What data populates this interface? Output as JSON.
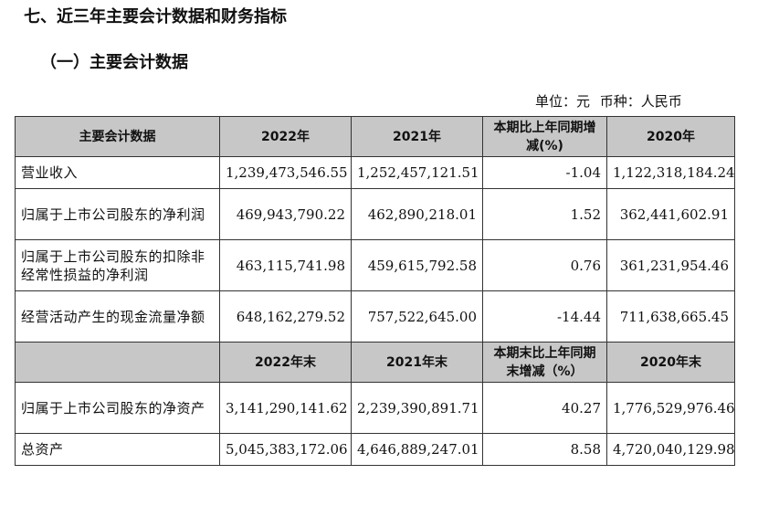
{
  "heading": "七、近三年主要会计数据和财务指标",
  "subheading": "（一）主要会计数据",
  "unit_label": "单位：元",
  "currency_label": "币种：人民币",
  "table": {
    "header1": [
      "主要会计数据",
      "2022年",
      "2021年",
      "本期比上年同期增减(%)",
      "2020年"
    ],
    "rows1": [
      [
        "营业收入",
        "1,239,473,546.55",
        "1,252,457,121.51",
        "-1.04",
        "1,122,318,184.24"
      ],
      [
        "归属于上市公司股东的净利润",
        "469,943,790.22",
        "462,890,218.01",
        "1.52",
        "362,441,602.91"
      ],
      [
        "归属于上市公司股东的扣除非经常性损益的净利润",
        "463,115,741.98",
        "459,615,792.58",
        "0.76",
        "361,231,954.46"
      ],
      [
        "经营活动产生的现金流量净额",
        "648,162,279.52",
        "757,522,645.00",
        "-14.44",
        "711,638,665.45"
      ]
    ],
    "header2": [
      "",
      "2022年末",
      "2021年末",
      "本期末比上年同期末增减（%）",
      "2020年末"
    ],
    "rows2": [
      [
        "归属于上市公司股东的净资产",
        "3,141,290,141.62",
        "2,239,390,891.71",
        "40.27",
        "1,776,529,976.46"
      ],
      [
        "总资产",
        "5,045,383,172.06",
        "4,646,889,247.01",
        "8.58",
        "4,720,040,129.98"
      ]
    ]
  }
}
